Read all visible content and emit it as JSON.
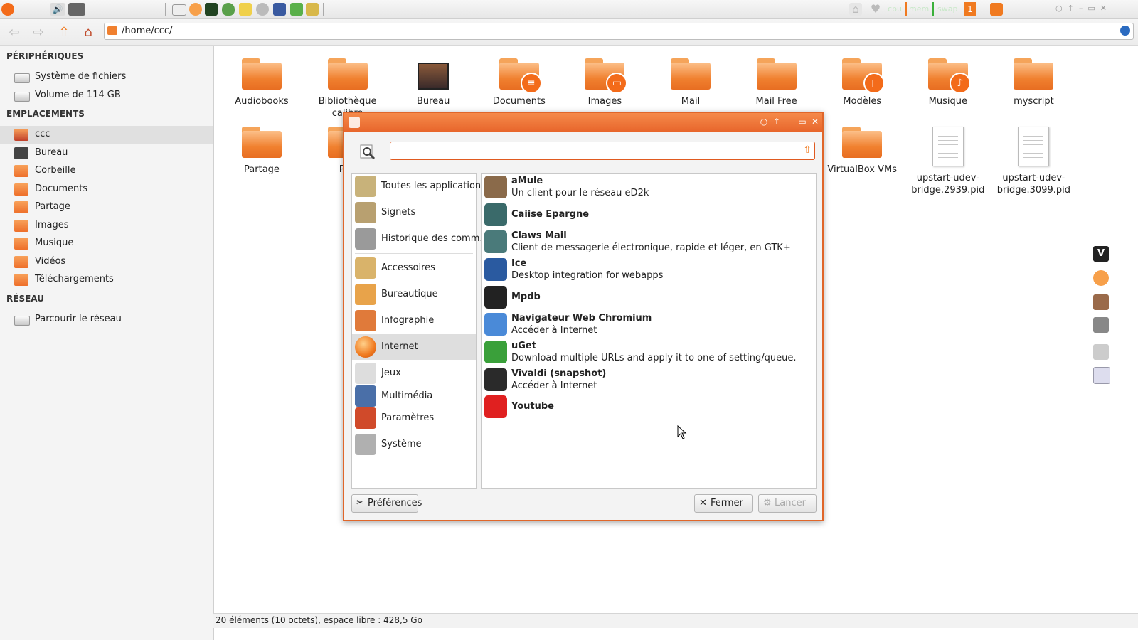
{
  "panel": {
    "meters": [
      "cpu",
      "mem",
      "swap"
    ],
    "badge": "1",
    "icons": [
      "menu-icon",
      "volume-icon",
      "app-icon",
      "mail-icon",
      "firefox-icon",
      "monitor-icon",
      "shield-icon",
      "note-icon",
      "network-icon",
      "graph-icon",
      "plant-icon",
      "bee-icon",
      "home-icon",
      "heart-icon",
      "trash-icon"
    ]
  },
  "toolbar": {
    "path": "/home/ccc/"
  },
  "sidebar": {
    "sections": [
      {
        "title": "PÉRIPHÉRIQUES",
        "items": [
          {
            "label": "Système de fichiers",
            "icon": "drive-icon"
          },
          {
            "label": "Volume de 114 GB",
            "icon": "drive-icon"
          }
        ]
      },
      {
        "title": "EMPLACEMENTS",
        "items": [
          {
            "label": "ccc",
            "icon": "home-folder-icon"
          },
          {
            "label": "Bureau",
            "icon": "desktop-icon"
          },
          {
            "label": "Corbeille",
            "icon": "trash-icon"
          },
          {
            "label": "Documents",
            "icon": "folder-icon"
          },
          {
            "label": "Partage",
            "icon": "folder-icon"
          },
          {
            "label": "Images",
            "icon": "folder-icon"
          },
          {
            "label": "Musique",
            "icon": "folder-icon"
          },
          {
            "label": "Vidéos",
            "icon": "folder-icon"
          },
          {
            "label": "Téléchargements",
            "icon": "folder-icon"
          }
        ]
      },
      {
        "title": "RÉSEAU",
        "items": [
          {
            "label": "Parcourir le réseau",
            "icon": "network-icon"
          }
        ]
      }
    ]
  },
  "files": [
    {
      "name": "Audiobooks",
      "type": "folder"
    },
    {
      "name": "Bibliothèque calibre",
      "type": "folder"
    },
    {
      "name": "Bureau",
      "type": "desktop"
    },
    {
      "name": "Documents",
      "type": "folder",
      "emblem": "≡"
    },
    {
      "name": "Images",
      "type": "folder",
      "emblem": "▭"
    },
    {
      "name": "Mail",
      "type": "folder"
    },
    {
      "name": "Mail Free",
      "type": "folder"
    },
    {
      "name": "Modèles",
      "type": "folder",
      "emblem": "▯"
    },
    {
      "name": "Musique",
      "type": "folder",
      "emblem": "♪"
    },
    {
      "name": "myscript",
      "type": "folder"
    },
    {
      "name": "Partage",
      "type": "folder"
    },
    {
      "name": "Pod",
      "type": "folder"
    },
    {
      "name": "VirtualBox VMs",
      "type": "folder"
    },
    {
      "name": "upstart-udev-\nbridge.2939.pid",
      "type": "doc"
    },
    {
      "name": "upstart-udev-\nbridge.3099.pid",
      "type": "doc"
    }
  ],
  "status": "20 éléments (10 octets), espace libre : 428,5 Go",
  "dialog": {
    "search_value": "",
    "categories": [
      {
        "label": "Toutes les applications",
        "color": "#c8b27a"
      },
      {
        "label": "Signets",
        "color": "#b8a070"
      },
      {
        "label": "Historique des comm...",
        "color": "#9a9a9a"
      },
      {
        "label": "Accessoires",
        "color": "#d9b36a"
      },
      {
        "label": "Bureautique",
        "color": "#e8a34a"
      },
      {
        "label": "Infographie",
        "color": "#e07a3a"
      },
      {
        "label": "Internet",
        "color": "#f07a20",
        "selected": true
      },
      {
        "label": "Jeux",
        "color": "#dddddd"
      },
      {
        "label": "Multimédia",
        "color": "#4a6fa8"
      },
      {
        "label": "Paramètres",
        "color": "#d04a2a"
      },
      {
        "label": "Système",
        "color": "#b0b0b0"
      }
    ],
    "apps": [
      {
        "name": "aMule",
        "desc": "Un client pour le réseau eD2k",
        "color": "#8a6a4a"
      },
      {
        "name": "Caiise Epargne",
        "desc": "",
        "color": "#3a6a6a"
      },
      {
        "name": "Claws Mail",
        "desc": "Client de messagerie électronique, rapide et léger, en GTK+",
        "color": "#4a7a7a"
      },
      {
        "name": "Ice",
        "desc": "Desktop integration for webapps",
        "color": "#2a5aa0"
      },
      {
        "name": "Mpdb",
        "desc": "",
        "color": "#222222"
      },
      {
        "name": "Navigateur Web Chromium",
        "desc": "Accéder à Internet",
        "color": "#4a8ad8"
      },
      {
        "name": "uGet",
        "desc": "Download multiple URLs and apply it to one of setting/queue.",
        "color": "#3aa03a"
      },
      {
        "name": "Vivaldi (snapshot)",
        "desc": "Accéder à Internet",
        "color": "#2a2a2a"
      },
      {
        "name": "Youtube",
        "desc": "",
        "color": "#e02020"
      }
    ],
    "buttons": {
      "preferences": "Préférences",
      "close": "Fermer",
      "launch": "Lancer"
    }
  },
  "colors": {
    "accent": "#e8662c",
    "folder": "#f0802f"
  }
}
